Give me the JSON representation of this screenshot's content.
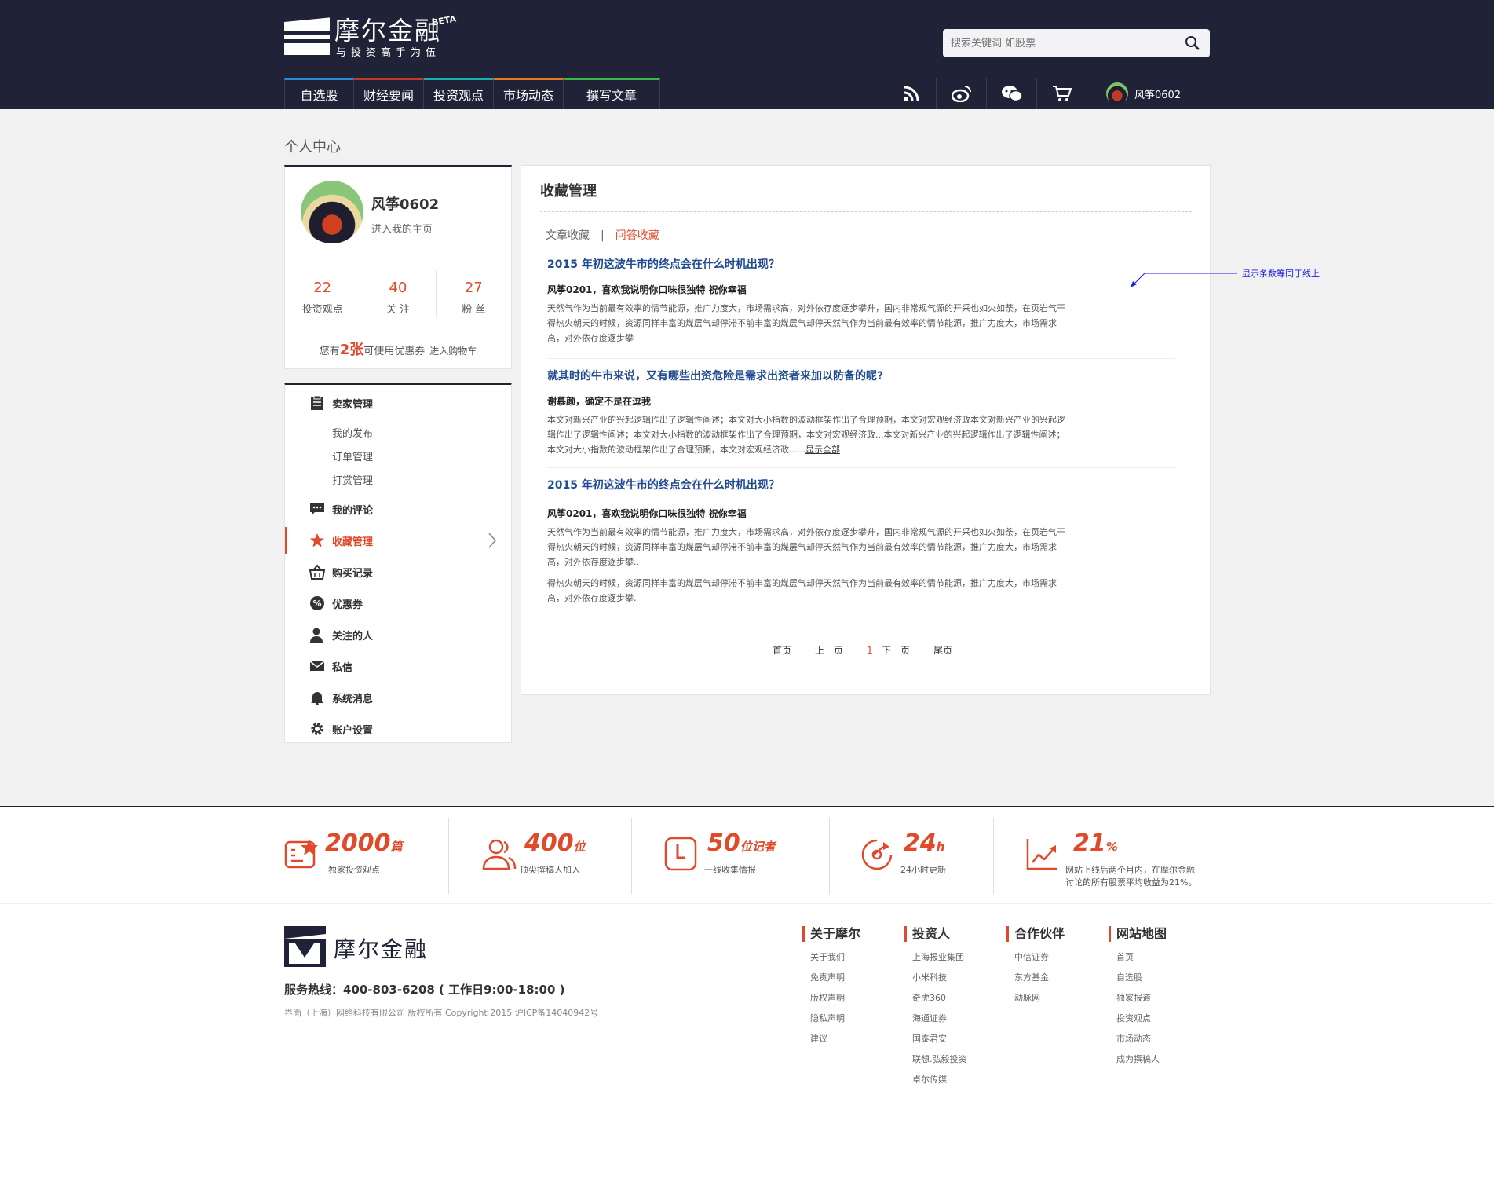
{
  "header": {
    "logo_title": "摩尔金融",
    "logo_slogan": "与投资高手为伍",
    "beta": "BETA",
    "search_placeholder": "搜索关键词 如股票",
    "nav": [
      "自选股",
      "财经要闻",
      "投资观点",
      "市场动态",
      "撰写文章"
    ],
    "user_name": "风筝0602",
    "colors": {
      "bg": "#202237",
      "accent": "#e04a2a"
    }
  },
  "breadcrumb": "个人中心",
  "profile": {
    "name": "风筝0602",
    "home_link": "进入我的主页",
    "stats": [
      {
        "value": "22",
        "label": "投资观点"
      },
      {
        "value": "40",
        "label": "关 注"
      },
      {
        "value": "27",
        "label": "粉 丝"
      }
    ],
    "coupon_prefix": "您有",
    "coupon_count": "2张",
    "coupon_suffix": "可使用优惠券",
    "coupon_link": "进入购物车"
  },
  "menu": {
    "seller": "卖家管理",
    "seller_subs": [
      "我的发布",
      "订单管理",
      "打赏管理"
    ],
    "comments": "我的评论",
    "favorites": "收藏管理",
    "purchases": "购买记录",
    "coupons": "优惠券",
    "following": "关注的人",
    "messages": "私信",
    "notifications": "系统消息",
    "settings": "账户设置"
  },
  "main": {
    "title": "收藏管理",
    "tab_articles": "文章收藏",
    "tab_sep": "|",
    "tab_qa": "问答收藏",
    "items": [
      {
        "q": "2015 年初这波牛市的终点会在什么时机出现？",
        "a": "风筝0201，喜欢我说明你口味很独特 祝你幸福",
        "b": "天然气作为当前最有效率的情节能源，推广力度大，市场需求高，对外依存度逐步攀升，国内非常规气源的开采也如火如荼，在页岩气干得热火朝天的时候，资源同样丰富的煤层气却停滞不前丰富的煤层气却停天然气作为当前最有效率的情节能源，推广力度大，市场需求高，对外依存度逐步攀"
      },
      {
        "q": "就其时的牛市来说，又有哪些出资危险是需求出资者来加以防备的呢?",
        "a": "谢慕颜，确定不是在逗我",
        "b": "本文对新兴产业的兴起逻辑作出了逻辑性阐述；本文对大小指数的波动框架作出了合理预期，本文对宏观经济政本文对新兴产业的兴起逻辑作出了逻辑性阐述；本文对大小指数的波动框架作出了合理预期，本文对宏观经济政...本文对新兴产业的兴起逻辑作出了逻辑性阐述；本文对大小指数的波动框架作出了合理预期，本文对宏观经济政......",
        "more": "显示全部"
      },
      {
        "q": "2015 年初这波牛市的终点会在什么时机出现？",
        "a": "风筝0201，喜欢我说明你口味很独特 祝你幸福",
        "b": "天然气作为当前最有效率的情节能源，推广力度大，市场需求高，对外依存度逐步攀升，国内非常规气源的开采也如火如荼，在页岩气干得热火朝天的时候，资源同样丰富的煤层气却停滞不前丰富的煤层气却停天然气作为当前最有效率的情节能源，推广力度大，市场需求高，对外依存度逐步攀..",
        "b2": "得热火朝天的时候，资源同样丰富的煤层气却停滞不前丰富的煤层气却停天然气作为当前最有效率的情节能源，推广力度大，市场需求高，对外依存度逐步攀."
      }
    ],
    "pager": {
      "first": "首页",
      "prev": "上一页",
      "current": "1",
      "next": "下一页",
      "last": "尾页"
    }
  },
  "annotation": "显示条数等同于线上",
  "footer_stats": [
    {
      "num": "2000",
      "unit": "篇",
      "cap": "独家投资观点"
    },
    {
      "num": "400",
      "unit": "位",
      "cap": "顶尖撰稿人加入"
    },
    {
      "num": "50",
      "unit": "位记者",
      "cap": "一线收集情报"
    },
    {
      "num": "24",
      "unit": "h",
      "cap": "24小时更新"
    },
    {
      "num": "21",
      "unit": "%",
      "cap": "网站上线后两个月内，在摩尔金融",
      "cap2": "讨论的所有股票平均收益为21%。"
    }
  ],
  "footer": {
    "logo": "摩尔金融",
    "hotline": "服务热线：400-803-6208 ( 工作日9:00-18:00 )",
    "copyright": "界面（上海）网络科技有限公司 版权所有 Copyright 2015 沪ICP备14040942号",
    "cols": [
      {
        "title": "关于摩尔",
        "links": [
          "关于我们",
          "免责声明",
          "版权声明",
          "隐私声明",
          "建议"
        ]
      },
      {
        "title": "投资人",
        "links": [
          "上海报业集团",
          "小米科技",
          "奇虎360",
          "海通证券",
          "国泰君安",
          "联想.弘毅投资",
          "卓尔传媒"
        ]
      },
      {
        "title": "合作伙伴",
        "links": [
          "中信证券",
          "东方基金",
          "动脉网"
        ]
      },
      {
        "title": "网站地图",
        "links": [
          "首页",
          "自选股",
          "独家报道",
          "投资观点",
          "市场动态",
          "成为撰稿人"
        ]
      }
    ]
  }
}
